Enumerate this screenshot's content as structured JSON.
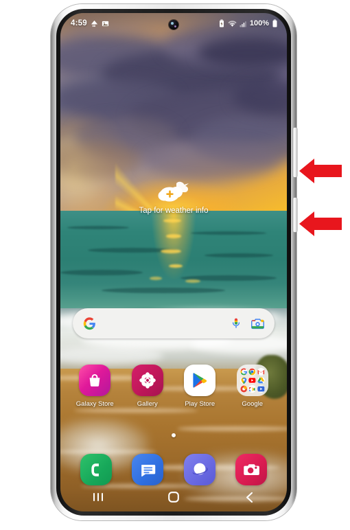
{
  "device": {
    "name": "Samsung Galaxy smartphone",
    "frame_color": "#ffffff"
  },
  "status_bar": {
    "time": "4:59",
    "battery_percent": "100%",
    "icons": [
      {
        "name": "network-quality-icon",
        "label": "NQ"
      },
      {
        "name": "image-icon",
        "label": "IMG"
      },
      {
        "name": "battery-saver-icon",
        "label": "BS"
      },
      {
        "name": "wifi-icon",
        "label": "WiFi"
      },
      {
        "name": "signal-icon",
        "label": "Signal"
      },
      {
        "name": "battery-icon",
        "label": "Battery"
      }
    ]
  },
  "weather_widget": {
    "label": "Tap for weather info",
    "icon": "cloud-plus-icon"
  },
  "search": {
    "placeholder": "",
    "value": "",
    "logo": "google-g-icon",
    "mic": "microphone-icon",
    "lens": "google-lens-camera-icon"
  },
  "apps": [
    {
      "label": "Galaxy Store",
      "icon": "galaxy-store-icon",
      "color": "#e6329a"
    },
    {
      "label": "Gallery",
      "icon": "gallery-icon",
      "color": "#c9195e"
    },
    {
      "label": "Play Store",
      "icon": "play-store-icon",
      "color": "#ffffff"
    },
    {
      "label": "Google",
      "icon": "google-folder-icon",
      "color": "#f3f3f3"
    }
  ],
  "google_folder": [
    {
      "name": "google-icon",
      "glyph": "G",
      "color": "#ffffff",
      "fg": "#4285f4"
    },
    {
      "name": "chrome-icon",
      "glyph": "",
      "color": "#ffffff",
      "fg": "#1a73e8"
    },
    {
      "name": "gmail-icon",
      "glyph": "M",
      "color": "#ffffff",
      "fg": "#ea4335"
    },
    {
      "name": "maps-icon",
      "glyph": "",
      "color": "#ffffff",
      "fg": "#34a853"
    },
    {
      "name": "youtube-icon",
      "glyph": "",
      "color": "#ff0000",
      "fg": "#ffffff"
    },
    {
      "name": "drive-icon",
      "glyph": "",
      "color": "#ffffff",
      "fg": "#fbbc04"
    },
    {
      "name": "photos-icon",
      "glyph": "",
      "color": "#ea4335",
      "fg": "#ffffff"
    },
    {
      "name": "meet-icon",
      "glyph": "",
      "color": "#ffffff",
      "fg": "#ea4335"
    },
    {
      "name": "youtube-music-icon",
      "glyph": "",
      "color": "#3367d6",
      "fg": "#ffffff"
    }
  ],
  "page_indicator": {
    "total": 1,
    "active": 1
  },
  "dock": [
    {
      "label": "Phone",
      "icon": "phone-icon",
      "color": "#1fab5a"
    },
    {
      "label": "Messages",
      "icon": "messages-icon",
      "color": "#2f6fe0"
    },
    {
      "label": "Internet",
      "icon": "samsung-internet-icon",
      "color": "#6b6be0"
    },
    {
      "label": "Camera",
      "icon": "camera-icon",
      "color": "#d81b50"
    }
  ],
  "nav_bar": [
    {
      "name": "recents-button",
      "icon": "recents-icon"
    },
    {
      "name": "home-button",
      "icon": "home-circle-icon"
    },
    {
      "name": "back-button",
      "icon": "back-chevron-icon"
    }
  ],
  "annotations": {
    "arrow_color": "#e8161d",
    "arrows": [
      {
        "name": "volume-button-arrow",
        "points_to": "volume-button"
      },
      {
        "name": "power-button-arrow",
        "points_to": "power-button"
      }
    ]
  },
  "side_buttons": [
    {
      "name": "volume-button",
      "label": "Volume"
    },
    {
      "name": "power-button",
      "label": "Power / Side key"
    }
  ]
}
